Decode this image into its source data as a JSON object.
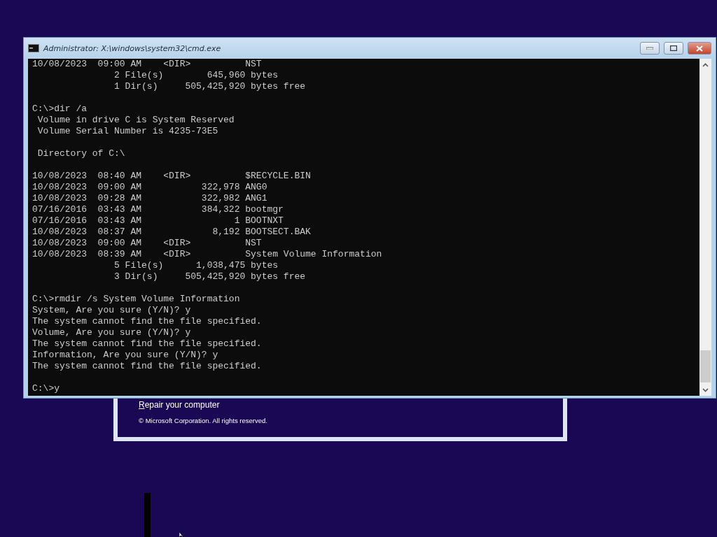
{
  "setup_dialog": {
    "repair_link": "Repair your computer",
    "copyright": "© Microsoft Corporation. All rights reserved."
  },
  "window": {
    "title": "Administrator: X:\\windows\\system32\\cmd.exe"
  },
  "console": {
    "blocks": [
      [
        "10/08/2023  09:00 AM    <DIR>          NST",
        "               2 File(s)        645,960 bytes",
        "               1 Dir(s)     505,425,920 bytes free"
      ],
      [
        "C:\\>dir /a",
        " Volume in drive C is System Reserved",
        " Volume Serial Number is 4235-73E5"
      ],
      [
        " Directory of C:\\"
      ],
      [
        "10/08/2023  08:40 AM    <DIR>          $RECYCLE.BIN",
        "10/08/2023  09:00 AM           322,978 ANG0",
        "10/08/2023  09:28 AM           322,982 ANG1",
        "07/16/2016  03:43 AM           384,322 bootmgr",
        "07/16/2016  03:43 AM                 1 BOOTNXT",
        "10/08/2023  08:37 AM             8,192 BOOTSECT.BAK",
        "10/08/2023  09:00 AM    <DIR>          NST",
        "10/08/2023  08:39 AM    <DIR>          System Volume Information",
        "               5 File(s)      1,038,475 bytes",
        "               3 Dir(s)     505,425,920 bytes free"
      ],
      [
        "C:\\>rmdir /s System Volume Information",
        "System, Are you sure (Y/N)? y",
        "The system cannot find the file specified.",
        "Volume, Are you sure (Y/N)? y",
        "The system cannot find the file specified.",
        "Information, Are you sure (Y/N)? y",
        "The system cannot find the file specified."
      ],
      [
        "C:\\>y"
      ]
    ]
  }
}
